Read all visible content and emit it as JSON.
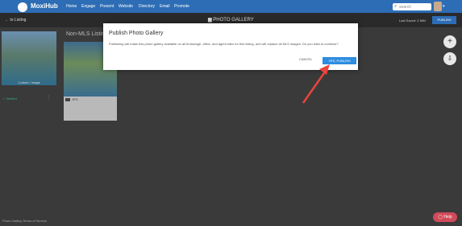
{
  "topnav": {
    "brand": "MoxiHub",
    "items": [
      "Home",
      "Engage",
      "Present",
      "Website",
      "Directory",
      "Email",
      "Promote"
    ],
    "search_placeholder": "search"
  },
  "subbar": {
    "back_label": "to Listing",
    "title": "PHOTO GALLERY",
    "saved_text": "Last Saved: 2 MIN",
    "publish_label": "PUBLISH"
  },
  "gallery": {
    "card1_caption": "1 photo / image",
    "verified_label": "Verified",
    "nonmls_label": "Non-MLS Listin",
    "tag_text": "JPG"
  },
  "modal": {
    "title": "Publish Photo Gallery",
    "body": "Publishing will make this photo gallery available on all brokerage, office, and agent sites for this listing, and will replace all MLS images. Do you wish to continue?",
    "cancel_label": "CANCEL",
    "confirm_label": "YES, PUBLISH"
  },
  "footer": {
    "text": "Photo Gallery Terms of Service"
  },
  "help": {
    "label": "Help"
  }
}
